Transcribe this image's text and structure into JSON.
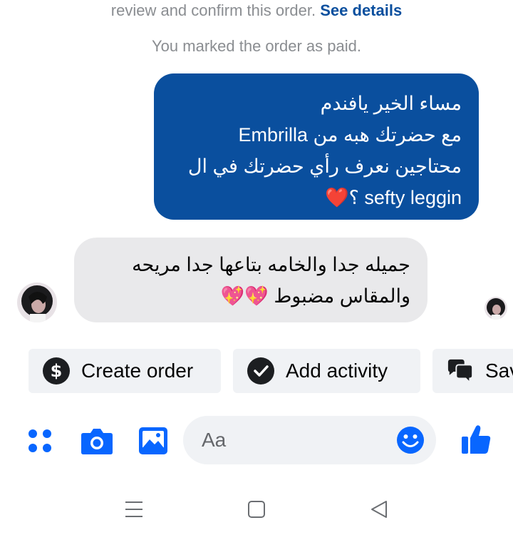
{
  "system": {
    "review_text": "review and confirm this order.",
    "see_details": "See details",
    "paid_text": "You marked the order as paid."
  },
  "messages": {
    "outgoing": {
      "lines": [
        "مساء الخير يافندم",
        "مع حضرتك هبه من Embrilla",
        "محتاجين نعرف رأي حضرتك في ال",
        "sefty leggin ؟❤️"
      ]
    },
    "incoming": {
      "lines": [
        "جميله جدا والخامه بتاعها جدا مريحه",
        "والمقاس مضبوط 💖💖"
      ]
    }
  },
  "actions": {
    "create_order": "Create order",
    "add_activity": "Add activity",
    "save_partial": "Sav"
  },
  "composer": {
    "placeholder": "Aa"
  },
  "colors": {
    "brand_blue": "#0a4f9e",
    "icon_blue": "#0866ff",
    "incoming_bg": "#e9e9eb",
    "chip_bg": "#f0f2f5"
  },
  "icons": {
    "menu": "grid-dots-icon",
    "camera": "camera-icon",
    "gallery": "image-icon",
    "emoji": "smiley-icon",
    "like": "thumbs-up-icon",
    "dollar": "dollar-icon",
    "check": "check-circle-icon",
    "saved_replies": "chat-bubbles-icon"
  }
}
